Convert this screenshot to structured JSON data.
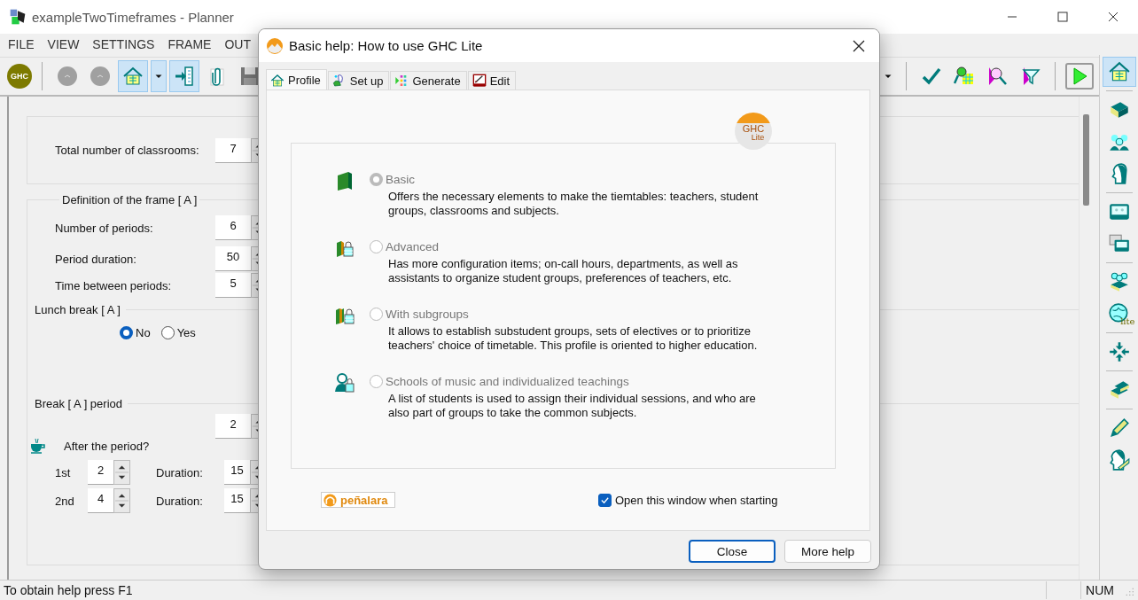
{
  "window": {
    "title": "exampleTwoTimeframes - Planner"
  },
  "menu": [
    "FILE",
    "VIEW",
    "SETTINGS",
    "FRAME",
    "OUT"
  ],
  "toolbar": {
    "logo": "GHC",
    "left": [
      [
        {
          "kind": "logo",
          "active": false
        }
      ],
      [
        {
          "kind": "circle",
          "active": false
        },
        {
          "kind": "circle",
          "active": false
        },
        {
          "kind": "house",
          "active": true
        },
        {
          "kind": "caret",
          "active": true
        },
        {
          "kind": "import",
          "active": true
        },
        {
          "kind": "clip",
          "active": false
        },
        {
          "kind": "disk",
          "active": false
        }
      ]
    ],
    "right": [
      [
        {
          "kind": "caret"
        }
      ],
      [
        {
          "kind": "checkmark"
        },
        {
          "kind": "grid-magnifier"
        },
        {
          "kind": "magnifier"
        },
        {
          "kind": "funnel"
        }
      ],
      [
        {
          "kind": "play"
        }
      ]
    ]
  },
  "side_toolbar": [
    [
      {
        "kind": "house",
        "active": true
      }
    ],
    [
      {
        "kind": "book",
        "active": false
      },
      {
        "kind": "people",
        "active": false
      },
      {
        "kind": "head",
        "active": false
      }
    ],
    [
      {
        "kind": "board",
        "active": false
      },
      {
        "kind": "boards",
        "active": false
      }
    ],
    [
      {
        "kind": "people-book",
        "active": false
      },
      {
        "kind": "globe",
        "active": false,
        "text": "lite"
      }
    ],
    [
      {
        "kind": "arrows",
        "active": false
      }
    ],
    [
      {
        "kind": "books",
        "active": false
      }
    ],
    [
      {
        "kind": "pencil",
        "active": false
      },
      {
        "kind": "head-pencil",
        "active": false
      }
    ]
  ],
  "classrooms": {
    "label": "Total number of classrooms:",
    "value": "7"
  },
  "frame": {
    "title": "Definition of the frame [ A ]",
    "fields": [
      {
        "label": "Number of periods:",
        "value": "6"
      },
      {
        "label": "Period duration:",
        "value": "50"
      },
      {
        "label": "Time between periods:",
        "value": "5"
      }
    ]
  },
  "lunch": {
    "title": "Lunch break [ A ]",
    "options": [
      {
        "label": "No",
        "selected": true
      },
      {
        "label": "Yes",
        "selected": false
      }
    ]
  },
  "break": {
    "title": "Break [ A ]  period",
    "count": "2",
    "question": "After the period?",
    "rows": [
      {
        "label": "1st",
        "period": "2",
        "duration_label": "Duration:",
        "duration": "15"
      },
      {
        "label": "2nd",
        "period": "4",
        "duration_label": "Duration:",
        "duration": "15"
      }
    ]
  },
  "dialog": {
    "title": "Basic help: How to use GHC Lite",
    "tabs": [
      {
        "label": "Profile",
        "kind": "house",
        "selected": true
      },
      {
        "label": "Set up",
        "kind": "setup",
        "selected": false
      },
      {
        "label": "Generate",
        "kind": "generate",
        "selected": false
      },
      {
        "label": "Edit",
        "kind": "edit",
        "selected": false
      }
    ],
    "logo": {
      "main": "GHC",
      "sub": "Lite"
    },
    "profiles": [
      {
        "kind": "basic",
        "label": "Basic",
        "selected": true,
        "disabled": true,
        "description": "Offers the necessary elements to make the tiemtables: teachers, student groups, classrooms and subjects."
      },
      {
        "kind": "advanced",
        "label": "Advanced",
        "selected": false,
        "disabled": true,
        "description": "Has more configuration items; on-call hours, departments, as well as assistants to organize student groups, preferences of teachers, etc."
      },
      {
        "kind": "subgroups",
        "label": "With subgroups",
        "selected": false,
        "disabled": true,
        "description": "It allows to establish substudent groups, sets of electives or to prioritize teachers' choice of timetable. This profile is oriented to higher education."
      },
      {
        "kind": "music",
        "label": "Schools of music and individualized teachings",
        "selected": false,
        "disabled": true,
        "description": "A list of students is used to assign their individual sessions, and who are also part of groups to take the common subjects."
      }
    ],
    "brand": "peñalara",
    "startup": {
      "label": "Open this window when starting",
      "checked": true
    },
    "buttons": [
      {
        "label": "Close",
        "default": true
      },
      {
        "label": "More help",
        "default": false
      }
    ]
  },
  "status_bar": {
    "help": "To obtain help press F1",
    "num": "NUM"
  }
}
